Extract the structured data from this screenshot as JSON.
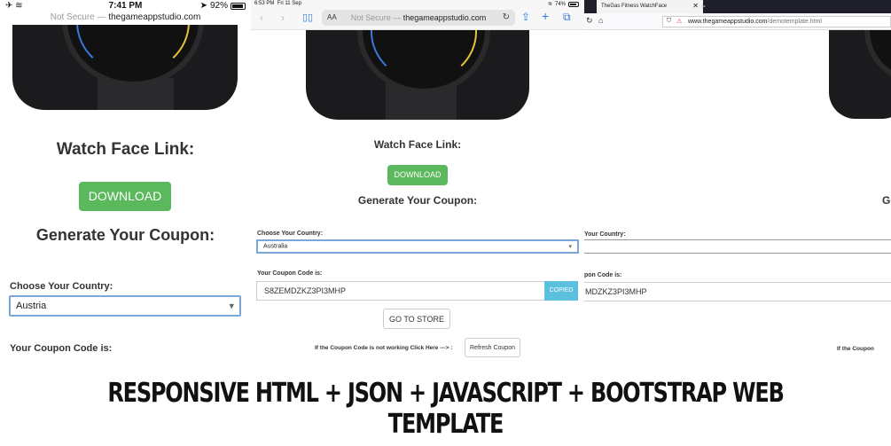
{
  "phone": {
    "status": {
      "time": "7:41 PM",
      "battery": "92%",
      "battery_fraction": 0.92
    },
    "url": {
      "prefix": "Not Secure — ",
      "domain": "thegameappstudio.com"
    },
    "watch_face_heading": "Watch Face Link:",
    "download_label": "DOWNLOAD",
    "coupon_heading": "Generate Your Coupon:",
    "country_label": "Choose Your Country:",
    "country_value": "Austria",
    "code_label": "Your Coupon Code is:"
  },
  "tablet": {
    "status": {
      "time": "6:53 PM",
      "date": "Fri 11 Sep",
      "battery": "74%",
      "battery_fraction": 0.74
    },
    "url": {
      "aa": "AA",
      "prefix": "Not Secure — ",
      "domain": "thegameappstudio.com"
    },
    "watch_face_heading": "Watch Face Link:",
    "download_label": "DOWNLOAD",
    "coupon_heading": "Generate Your Coupon:",
    "country_label": "Choose Your Country:",
    "country_value": "Australia",
    "code_label": "Your Coupon Code is:",
    "code_value": "S8ZEMDZKZ3PI3MHP",
    "copied_label": "COPIED",
    "store_label": "GO TO STORE",
    "refresh_prompt": "If the Coupon Code is not working Click Here ---> :",
    "refresh_label": "Refresh Coupon"
  },
  "desktop": {
    "tab_title": "TheGas Fitness WatchFace",
    "url": {
      "domain": "www.thegameappstudio.com",
      "path": "/demotemplate.html"
    },
    "coupon_heading_partial": "Go",
    "country_label_partial": "Your Country:",
    "code_label_partial": "pon Code is:",
    "code_value_partial": "MDZKZ3PI3MHP",
    "refresh_prompt_partial": "If the Coupon"
  },
  "banner": "RESPONSIVE HTML + JSON + JAVASCRIPT + BOOTSTRAP WEB TEMPLATE",
  "icons": {
    "airplane": "airplane-icon",
    "wifi": "wifi-icon",
    "location": "location-icon",
    "battery": "battery-icon"
  }
}
